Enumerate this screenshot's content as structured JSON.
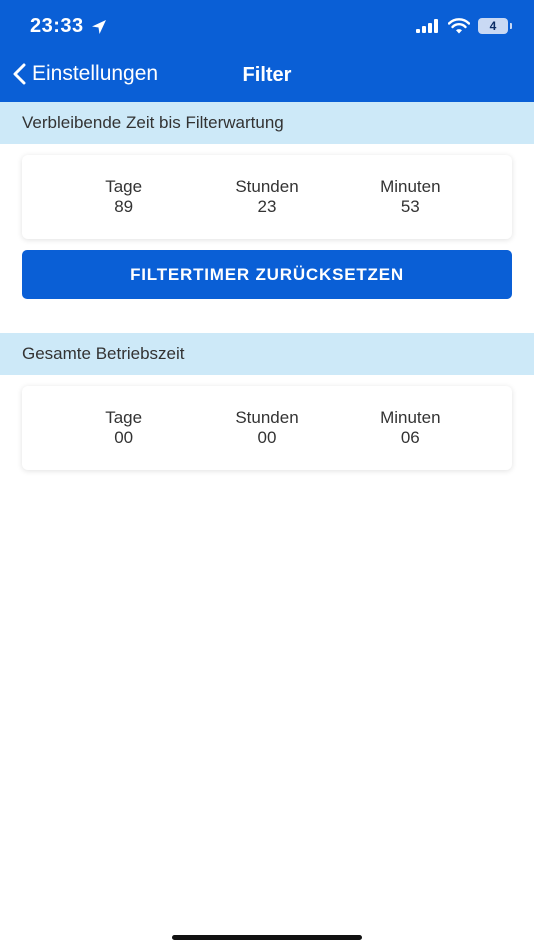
{
  "status_bar": {
    "time": "23:33",
    "battery_level": "4"
  },
  "nav": {
    "back_label": "Einstellungen",
    "title": "Filter"
  },
  "remaining": {
    "section_title": "Verbleibende Zeit bis Filterwartung",
    "days_label": "Tage",
    "days_value": "89",
    "hours_label": "Stunden",
    "hours_value": "23",
    "minutes_label": "Minuten",
    "minutes_value": "53"
  },
  "reset_button_label": "FILTERTIMER ZURÜCKSETZEN",
  "operating": {
    "section_title": "Gesamte Betriebszeit",
    "days_label": "Tage",
    "days_value": "00",
    "hours_label": "Stunden",
    "hours_value": "00",
    "minutes_label": "Minuten",
    "minutes_value": "06"
  },
  "colors": {
    "primary": "#0a5fd6",
    "section_bg": "#cde9f8",
    "text": "#333333"
  }
}
